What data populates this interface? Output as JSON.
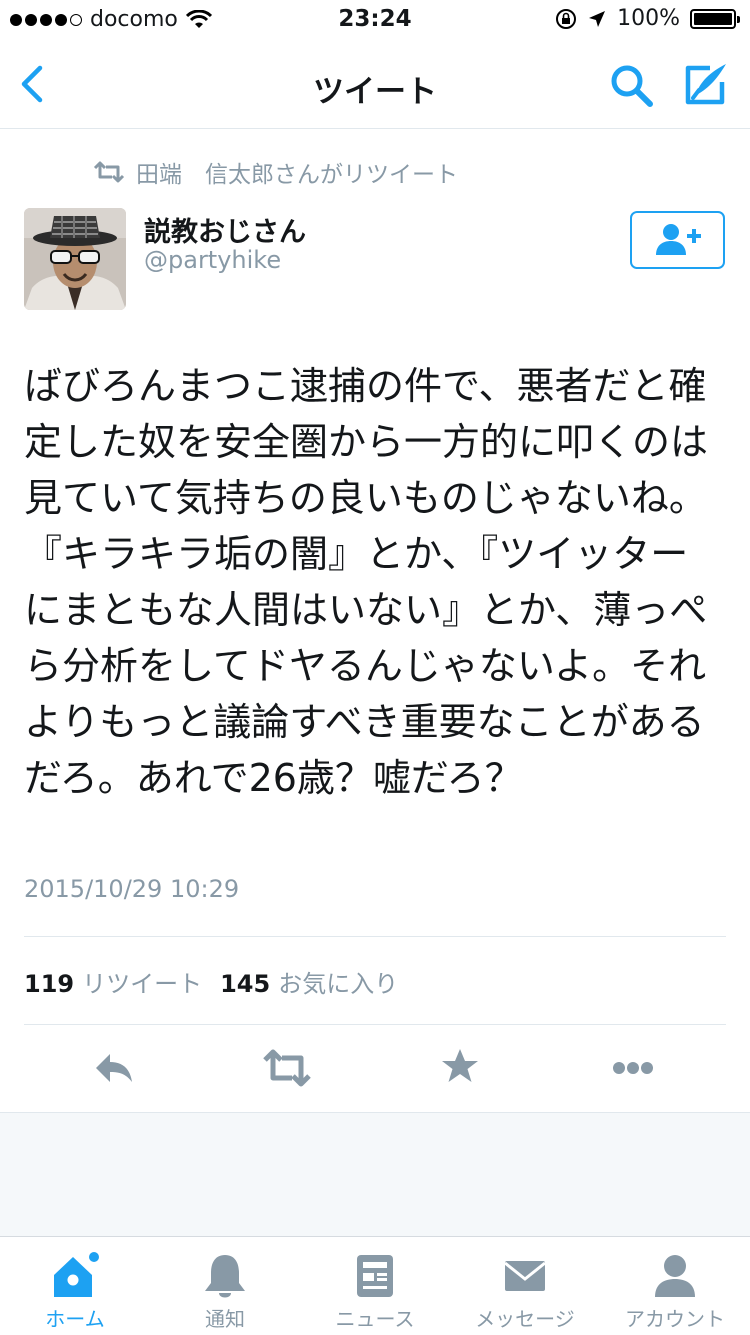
{
  "status_bar": {
    "carrier": "docomo",
    "time": "23:24",
    "battery": "100%",
    "battery_level": 1.0,
    "signal_bars": 4
  },
  "nav": {
    "title": "ツイート",
    "back_icon": "chevron-left-icon",
    "search_icon": "search-icon",
    "compose_icon": "compose-icon"
  },
  "tweet": {
    "retweeted_by": "田端　信太郎さんがリツイート",
    "display_name": "説教おじさん",
    "handle": "@partyhike",
    "text": "ばびろんまつこ逮捕の件で、悪者だと確定した奴を安全圏から一方的に叩くのは見ていて気持ちの良いものじゃないね。『キラキラ垢の闇』とか、『ツイッターにまともな人間はいない』とか、薄っぺら分析をしてドヤるんじゃないよ。それよりもっと議論すべき重要なことがあるだろ。あれで26歳？嘘だろ？",
    "timestamp": "2015/10/29 10:29",
    "retweet_count": "119",
    "retweet_label": "リツイート",
    "favorite_count": "145",
    "favorite_label": "お気に入り"
  },
  "tabs": [
    {
      "label": "ホーム",
      "icon": "home-icon",
      "active": true
    },
    {
      "label": "通知",
      "icon": "bell-icon",
      "active": false
    },
    {
      "label": "ニュース",
      "icon": "news-icon",
      "active": false
    },
    {
      "label": "メッセージ",
      "icon": "envelope-icon",
      "active": false
    },
    {
      "label": "アカウント",
      "icon": "person-icon",
      "active": false
    }
  ],
  "colors": {
    "accent": "#1da1f2",
    "muted": "#8899a6",
    "text": "#14171a"
  }
}
